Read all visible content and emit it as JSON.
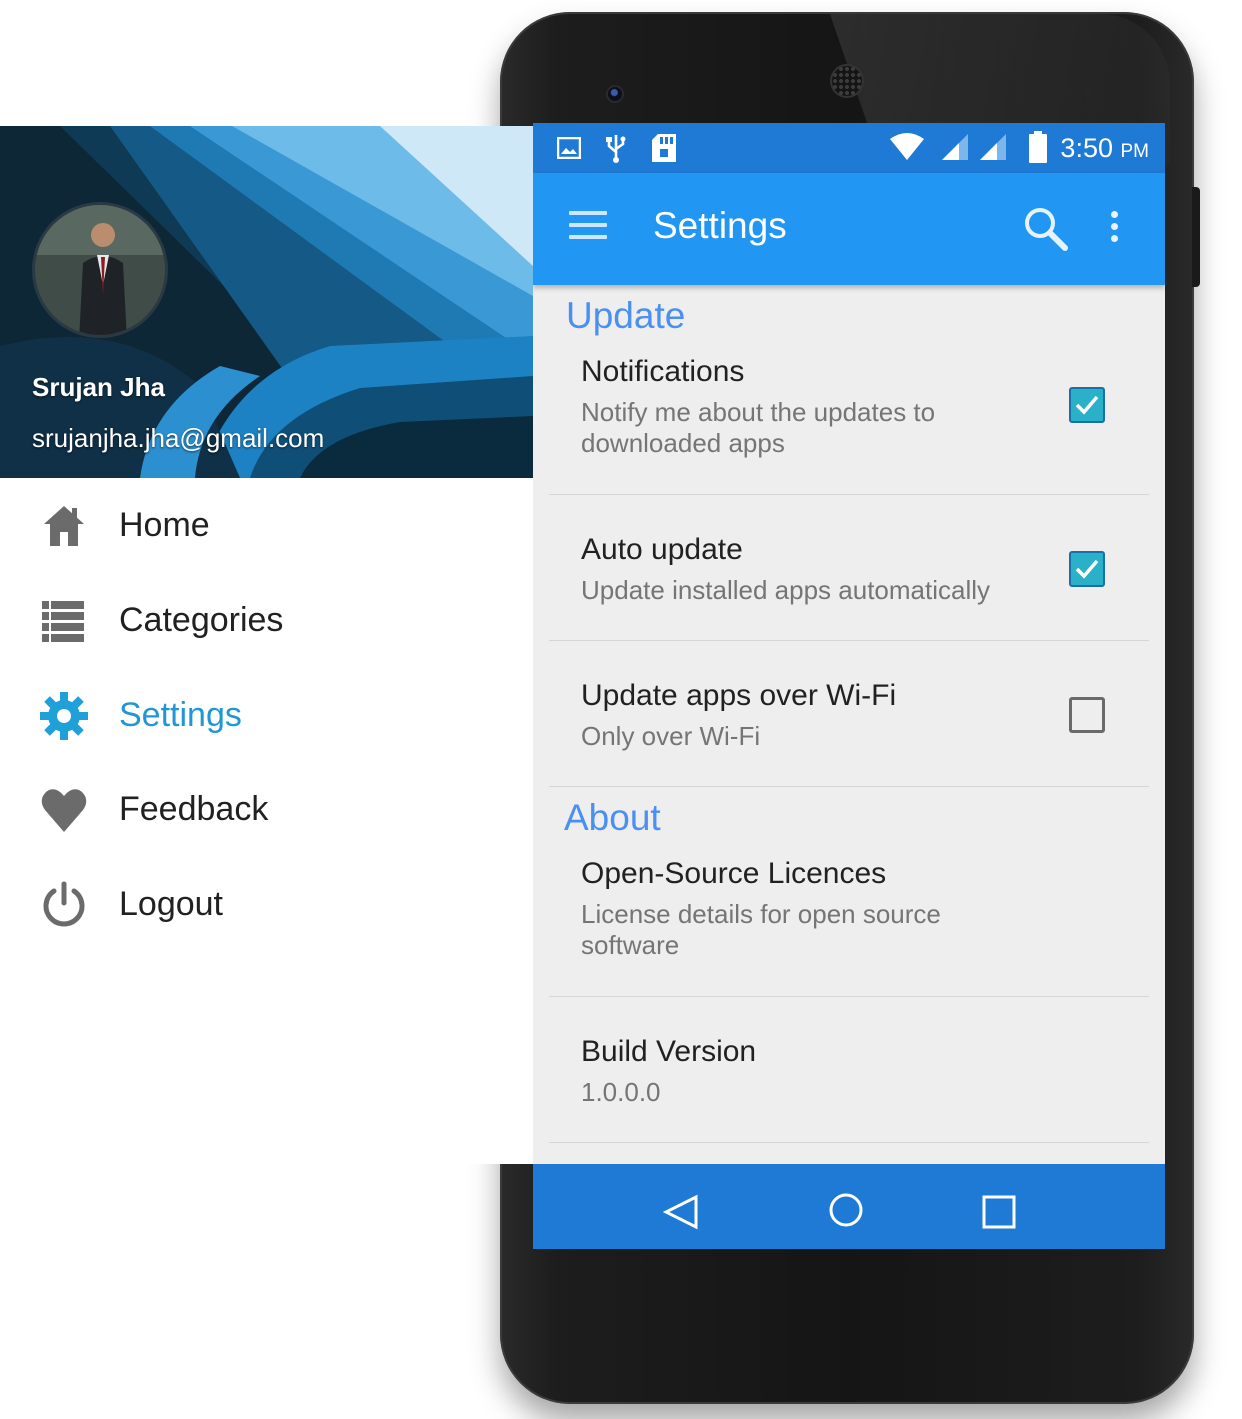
{
  "colors": {
    "status_bar": "#1e7ad4",
    "app_bar": "#2196f3",
    "accent": "#4a90f0",
    "checkbox_checked": "#2ab0c9",
    "drawer_active": "#2196d6",
    "nav_bar": "#1e7ad4"
  },
  "status_bar": {
    "icons": [
      "image-icon",
      "usb-icon",
      "sd-card-icon",
      "wifi-icon",
      "signal-icon",
      "signal-icon",
      "battery-icon"
    ],
    "time": "3:50",
    "ampm": "PM"
  },
  "app_bar": {
    "title": "Settings",
    "icons": [
      "menu-icon",
      "search-icon",
      "more-vert-icon"
    ]
  },
  "sections": [
    {
      "header": "Update",
      "items": [
        {
          "title": "Notifications",
          "summary": "Notify me about the updates to downloaded apps",
          "checked": true
        },
        {
          "title": "Auto update",
          "summary": "Update installed apps automatically",
          "checked": true
        },
        {
          "title": "Update apps over Wi-Fi",
          "summary": "Only over Wi-Fi",
          "checked": false
        }
      ]
    },
    {
      "header": "About",
      "items": [
        {
          "title": "Open-Source Licences",
          "summary": "License details for open source software"
        },
        {
          "title": "Build Version",
          "summary": "1.0.0.0"
        }
      ]
    }
  ],
  "nav_bar": {
    "icons": [
      "back-icon",
      "home-icon",
      "recents-icon"
    ]
  },
  "drawer": {
    "user_name": "Srujan Jha",
    "user_email": "srujanjha.jha@gmail.com",
    "items": [
      {
        "label": "Home",
        "icon": "home-icon",
        "active": false
      },
      {
        "label": "Categories",
        "icon": "list-icon",
        "active": false
      },
      {
        "label": "Settings",
        "icon": "gear-icon",
        "active": true
      },
      {
        "label": "Feedback",
        "icon": "heart-icon",
        "active": false
      },
      {
        "label": "Logout",
        "icon": "power-icon",
        "active": false
      }
    ]
  }
}
